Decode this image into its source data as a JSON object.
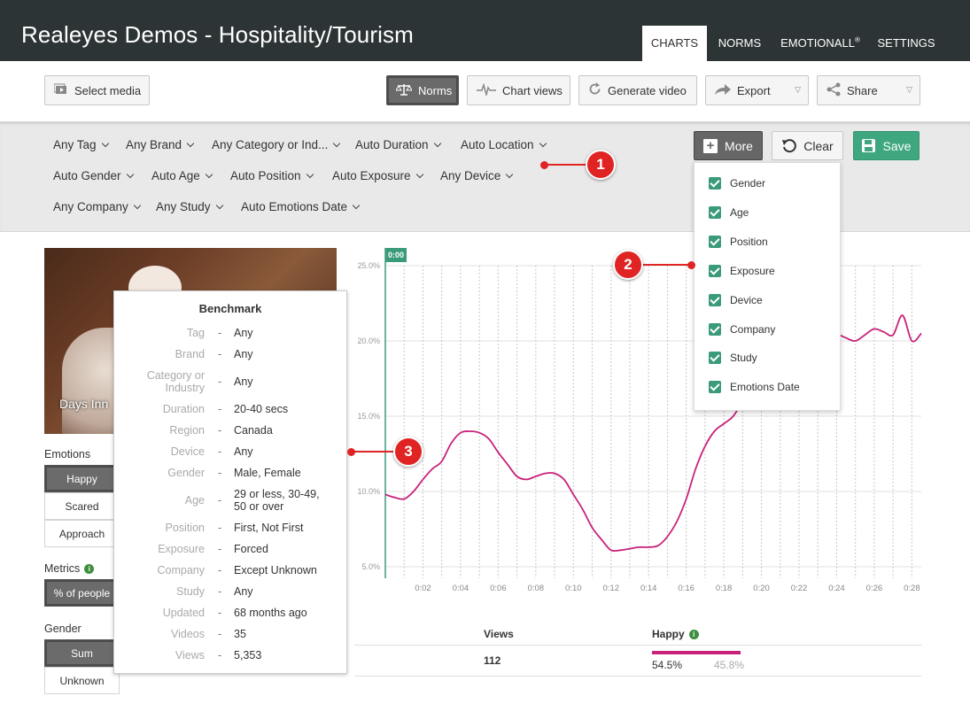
{
  "app": {
    "title": "Realeyes Demos - Hospitality/Tourism"
  },
  "nav": {
    "tabs": [
      {
        "label": "CHARTS",
        "active": true
      },
      {
        "label": "NORMS",
        "active": false
      },
      {
        "label": "EMOTIONALL",
        "sup": "®",
        "active": false
      },
      {
        "label": "SETTINGS",
        "active": false
      }
    ]
  },
  "toolbar": {
    "select_media": "Select media",
    "norms": "Norms",
    "chart_views": "Chart views",
    "generate_video": "Generate video",
    "export": "Export",
    "share": "Share"
  },
  "filters": {
    "row1": [
      "Any Tag",
      "Any Brand",
      "Any Category or Ind...",
      "Auto Duration",
      "Auto Location"
    ],
    "row2": [
      "Auto Gender",
      "Auto Age",
      "Auto Position",
      "Auto Exposure",
      "Any Device"
    ],
    "row3": [
      "Any Company",
      "Any Study",
      "Auto Emotions Date"
    ],
    "more": "More",
    "clear": "Clear",
    "save": "Save"
  },
  "more_dropdown": {
    "items": [
      "Gender",
      "Age",
      "Position",
      "Exposure",
      "Device",
      "Company",
      "Study",
      "Emotions Date"
    ]
  },
  "callouts": [
    "1",
    "2",
    "3"
  ],
  "video": {
    "label": "Days Inn"
  },
  "sidebar": {
    "emotions_label": "Emotions",
    "emotions": [
      {
        "label": "Happy",
        "selected": true
      },
      {
        "label": "Scared",
        "selected": false
      },
      {
        "label": "Approach",
        "selected": false
      }
    ],
    "metrics_label": "Metrics",
    "metrics": [
      {
        "label": "% of people",
        "selected": true
      }
    ],
    "gender_label": "Gender",
    "gender": [
      {
        "label": "Sum",
        "selected": true
      },
      {
        "label": "Unknown",
        "selected": false
      }
    ]
  },
  "benchmark": {
    "title": "Benchmark",
    "rows": [
      {
        "key": "Tag",
        "value": "Any"
      },
      {
        "key": "Brand",
        "value": "Any"
      },
      {
        "key": "Category or Industry",
        "value": "Any"
      },
      {
        "key": "Duration",
        "value": "20-40 secs"
      },
      {
        "key": "Region",
        "value": "Canada"
      },
      {
        "key": "Device",
        "value": "Any"
      },
      {
        "key": "Gender",
        "value": "Male, Female"
      },
      {
        "key": "Age",
        "value": "29 or less, 30-49, 50 or over"
      },
      {
        "key": "Position",
        "value": "First, Not First"
      },
      {
        "key": "Exposure",
        "value": "Forced"
      },
      {
        "key": "Company",
        "value": "Except Unknown"
      },
      {
        "key": "Study",
        "value": "Any"
      },
      {
        "key": "Updated",
        "value": "68 months ago"
      },
      {
        "key": "Videos",
        "value": "35"
      },
      {
        "key": "Views",
        "value": "5,353"
      }
    ]
  },
  "chart_data": {
    "type": "line",
    "cursor_label": "0:00",
    "x": [
      0,
      0.5,
      1,
      1.5,
      2,
      2.5,
      3,
      3.5,
      4,
      4.5,
      5,
      5.5,
      6,
      6.5,
      7,
      7.5,
      8,
      8.5,
      9,
      9.5,
      10,
      10.5,
      11,
      11.5,
      12,
      12.5,
      13,
      13.5,
      14,
      14.5,
      15,
      15.5,
      16,
      16.5,
      17,
      17.5,
      18,
      18.5,
      19,
      19.5,
      20,
      20.5,
      21,
      21.5,
      22,
      22.5,
      23,
      23.5,
      24,
      24.5,
      25,
      25.5,
      26,
      26.5,
      27,
      27.5,
      28,
      28.5
    ],
    "series": [
      {
        "color": "#c8227a",
        "values": [
          9.8,
          9.6,
          9.5,
          10.0,
          10.8,
          11.5,
          12.0,
          13.2,
          13.9,
          14.0,
          13.9,
          13.5,
          12.6,
          11.8,
          11.0,
          10.8,
          11.0,
          11.2,
          11.2,
          10.8,
          9.8,
          8.8,
          7.6,
          6.8,
          6.1,
          6.1,
          6.2,
          6.3,
          6.3,
          6.4,
          7.0,
          8.0,
          9.5,
          11.5,
          13.0,
          14.0,
          14.5,
          15.0,
          16.0,
          17.0,
          18.0,
          18.8,
          19.5,
          20.0,
          20.5,
          20.8,
          21.0,
          20.8,
          20.5,
          20.2,
          20.0,
          20.4,
          20.8,
          20.6,
          20.4,
          21.7,
          20.0,
          20.5
        ]
      }
    ],
    "xticks": [
      "0:02",
      "0:04",
      "0:06",
      "0:08",
      "0:10",
      "0:12",
      "0:14",
      "0:16",
      "0:18",
      "0:20",
      "0:22",
      "0:24",
      "0:26",
      "0:28"
    ],
    "yticks": [
      "5.0%",
      "10.0%",
      "15.0%",
      "20.0%",
      "25.0%"
    ],
    "ylim": [
      5,
      25
    ],
    "xlim": [
      0,
      28.5
    ],
    "grid": true
  },
  "stats": {
    "views_label": "Views",
    "happy_label": "Happy",
    "views": "112",
    "happy_pct": "54.5%",
    "norm_pct": "45.8%",
    "bar_color": "#c8227a"
  }
}
